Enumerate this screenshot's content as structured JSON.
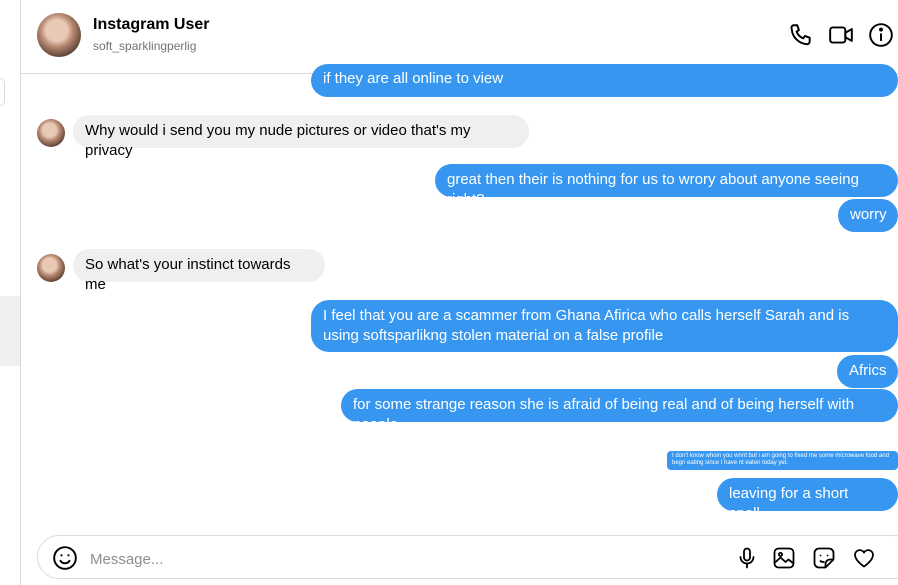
{
  "header": {
    "name": "Instagram User",
    "handle": "soft_sparklingperlig",
    "icons": [
      "phone-icon",
      "video-icon",
      "info-icon"
    ]
  },
  "messages": [
    {
      "dir": "out",
      "text": "if they are all online to view"
    },
    {
      "dir": "in",
      "text": "Why would i send you my nude pictures or video that's my privacy"
    },
    {
      "dir": "out",
      "text": "great then their is nothing for us to wrory about anyone seeing right?"
    },
    {
      "dir": "out",
      "text": "worry"
    },
    {
      "dir": "in",
      "text": "So what's your instinct towards me"
    },
    {
      "dir": "out",
      "text": "I feel that you are a scammer from Ghana Afirica who calls herself Sarah and is using softsparlikng stolen material on a false profile"
    },
    {
      "dir": "out",
      "text": "Africs"
    },
    {
      "dir": "out",
      "text": "for some strange reason she is afraid of being real and of being herself with people"
    },
    {
      "dir": "out",
      "text": "I don't know whoin you wnnt but i am going to fixed me some microwave food and begn eating since I have nt eaten today yet."
    },
    {
      "dir": "out",
      "text": "leaving for a short spell.."
    }
  ],
  "composer": {
    "placeholder": "Message...",
    "icons": [
      "emoji-icon",
      "microphone-icon",
      "image-icon",
      "sticker-icon",
      "heart-icon"
    ]
  }
}
